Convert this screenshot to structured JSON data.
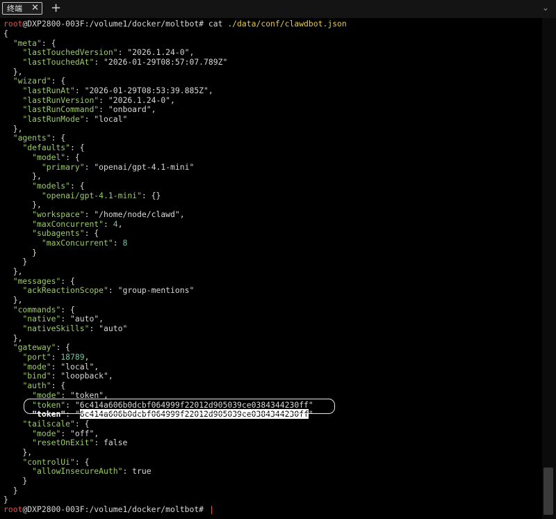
{
  "tab": {
    "label": "终端",
    "close_glyph": "✕"
  },
  "new_tab_glyph": "+",
  "collapse_glyph": "⌄",
  "prompt": {
    "user": "root",
    "host_path": "@DXP2800-003F:/volume1/docker/moltbot# ",
    "command": "cat ",
    "arg": "./data/conf/clawdbot.json"
  },
  "json_lines": [
    "{",
    "  \"meta\": {",
    "    \"lastTouchedVersion\": \"2026.1.24-0\",",
    "    \"lastTouchedAt\": \"2026-01-29T08:57:07.789Z\"",
    "  },",
    "  \"wizard\": {",
    "    \"lastRunAt\": \"2026-01-29T08:53:39.885Z\",",
    "    \"lastRunVersion\": \"2026.1.24-0\",",
    "    \"lastRunCommand\": \"onboard\",",
    "    \"lastRunMode\": \"local\"",
    "  },",
    "  \"agents\": {",
    "    \"defaults\": {",
    "      \"model\": {",
    "        \"primary\": \"openai/gpt-4.1-mini\"",
    "      },",
    "      \"models\": {",
    "        \"openai/gpt-4.1-mini\": {}",
    "      },",
    "      \"workspace\": \"/home/node/clawd\",",
    "      \"maxConcurrent\": 4,",
    "      \"subagents\": {",
    "        \"maxConcurrent\": 8",
    "      }",
    "    }",
    "  },",
    "  \"messages\": {",
    "    \"ackReactionScope\": \"group-mentions\"",
    "  },",
    "  \"commands\": {",
    "    \"native\": \"auto\",",
    "    \"nativeSkills\": \"auto\"",
    "  },",
    "  \"gateway\": {",
    "    \"port\": 18789,",
    "    \"mode\": \"local\",",
    "    \"bind\": \"loopback\",",
    "    \"auth\": {",
    "      \"mode\": \"token\",",
    "      \"token\": \"6c414a606b0dcbf064999f22012d905039ce0384344230ff\"",
    "    },",
    "    \"tailscale\": {",
    "      \"mode\": \"off\",",
    "      \"resetOnExit\": false",
    "    },",
    "    \"controlUi\": {",
    "      \"allowInsecureAuth\": true",
    "    }",
    "  }",
    "}"
  ],
  "token_line": {
    "indent": "      ",
    "key": "\"token\"",
    "sep": ": ",
    "quote_open": "\"",
    "value": "6c414a606b0dcbf064999f22012d905039ce0384344230ff",
    "quote_close": "\""
  },
  "highlighted_line_index": 40
}
